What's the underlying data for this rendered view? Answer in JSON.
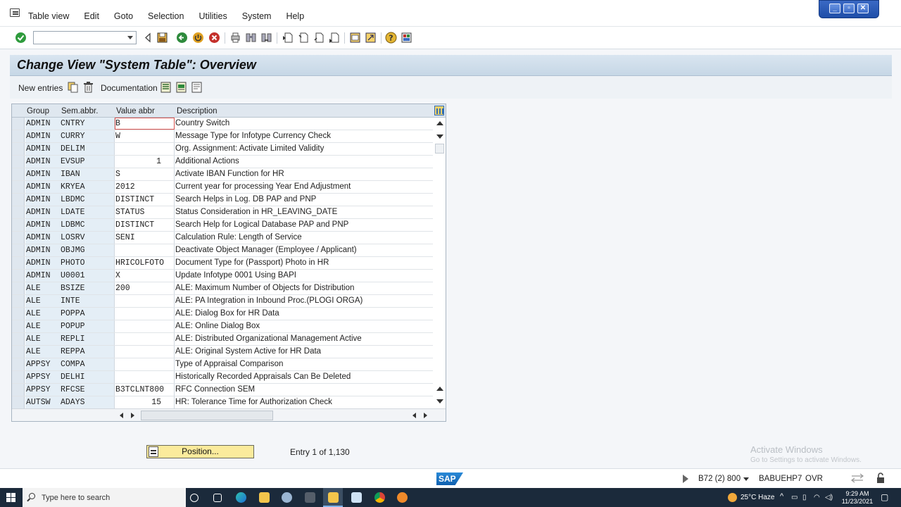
{
  "menu": {
    "items": [
      "Table view",
      "Edit",
      "Goto",
      "Selection",
      "Utilities",
      "System",
      "Help"
    ]
  },
  "window_controls": [
    "minimize",
    "restore",
    "close"
  ],
  "toolbar": {
    "command_field": {
      "value": ""
    },
    "icons": [
      "enter-icon",
      "back-icon",
      "save-icon",
      "back-green-icon",
      "exit-icon",
      "cancel-icon",
      "print-icon",
      "find-icon",
      "find-next-icon",
      "first-page-icon",
      "previous-page-icon",
      "next-page-icon",
      "last-page-icon",
      "create-session-icon",
      "shortcut-icon",
      "help-icon",
      "layout-icon"
    ]
  },
  "title": "Change View \"System Table\": Overview",
  "app_toolbar": {
    "new_entries": "New entries",
    "documentation": "Documentation"
  },
  "table": {
    "columns": [
      "Group",
      "Sem.abbr.",
      "Value abbr",
      "Description"
    ],
    "rows": [
      {
        "group": "ADMIN",
        "sem": "CNTRY",
        "value": "B",
        "desc": "Country Switch"
      },
      {
        "group": "ADMIN",
        "sem": "CURRY",
        "value": "W",
        "desc": "Message Type for Infotype Currency Check"
      },
      {
        "group": "ADMIN",
        "sem": "DELIM",
        "value": "",
        "desc": "Org. Assignment: Activate Limited Validity"
      },
      {
        "group": "ADMIN",
        "sem": "EVSUP",
        "value": "1",
        "desc": "Additional Actions"
      },
      {
        "group": "ADMIN",
        "sem": "IBAN",
        "value": "S",
        "desc": "Activate IBAN Function for HR"
      },
      {
        "group": "ADMIN",
        "sem": "KRYEA",
        "value": "2012",
        "desc": "Current year for processing Year End Adjustment"
      },
      {
        "group": "ADMIN",
        "sem": "LBDMC",
        "value": "DISTINCT",
        "desc": "Search Helps in Log. DB PAP and PNP"
      },
      {
        "group": "ADMIN",
        "sem": "LDATE",
        "value": "STATUS",
        "desc": "Status Consideration in HR_LEAVING_DATE"
      },
      {
        "group": "ADMIN",
        "sem": "LDBMC",
        "value": "DISTINCT",
        "desc": "Search Help for Logical Database PAP and PNP"
      },
      {
        "group": "ADMIN",
        "sem": "LOSRV",
        "value": "SENI",
        "desc": "Calculation Rule: Length of Service"
      },
      {
        "group": "ADMIN",
        "sem": "OBJMG",
        "value": "",
        "desc": "Deactivate Object Manager (Employee / Applicant)"
      },
      {
        "group": "ADMIN",
        "sem": "PHOTO",
        "value": "HRICOLFOTO",
        "desc": "Document Type for (Passport) Photo in HR"
      },
      {
        "group": "ADMIN",
        "sem": "U0001",
        "value": "X",
        "desc": "Update Infotype 0001 Using BAPI"
      },
      {
        "group": "ALE",
        "sem": "BSIZE",
        "value": "200",
        "desc": "ALE: Maximum Number of Objects for Distribution"
      },
      {
        "group": "ALE",
        "sem": "INTE",
        "value": "",
        "desc": "ALE: PA Integration in Inbound Proc.(PLOGI ORGA)"
      },
      {
        "group": "ALE",
        "sem": "POPPA",
        "value": "",
        "desc": "ALE: Dialog Box for HR Data"
      },
      {
        "group": "ALE",
        "sem": "POPUP",
        "value": "",
        "desc": "ALE: Online Dialog Box"
      },
      {
        "group": "ALE",
        "sem": "REPLI",
        "value": "",
        "desc": "ALE: Distributed Organizational Management Active"
      },
      {
        "group": "ALE",
        "sem": "REPPA",
        "value": "",
        "desc": "ALE: Original System Active for HR Data"
      },
      {
        "group": "APPSY",
        "sem": "COMPA",
        "value": "",
        "desc": "Type of Appraisal Comparison"
      },
      {
        "group": "APPSY",
        "sem": "DELHI",
        "value": "",
        "desc": "Historically Recorded Appraisals Can Be Deleted"
      },
      {
        "group": "APPSY",
        "sem": "RFCSE",
        "value": "B3TCLNT800",
        "desc": "RFC Connection SEM"
      },
      {
        "group": "AUTSW",
        "sem": "ADAYS",
        "value": "15",
        "desc": "HR: Tolerance Time for Authorization Check"
      }
    ]
  },
  "position_button": "Position...",
  "entry_info": "Entry 1 of 1,130",
  "watermark": {
    "title": "Activate Windows",
    "subtitle": "Go to Settings to activate Windows."
  },
  "status_bar": {
    "logo": "SAP",
    "system": "B72 (2) 800",
    "server": "BABUEHP7",
    "mode": "OVR"
  },
  "taskbar": {
    "search_placeholder": "Type here to search",
    "weather": "25°C  Haze",
    "time": "9:29 AM",
    "date": "11/23/2021"
  },
  "colors": {
    "title_bg": "#c6d7e6",
    "key_cell_bg": "#e4eef6",
    "position_button": "#fbeb9c",
    "taskbar": "#1b2a3b"
  }
}
